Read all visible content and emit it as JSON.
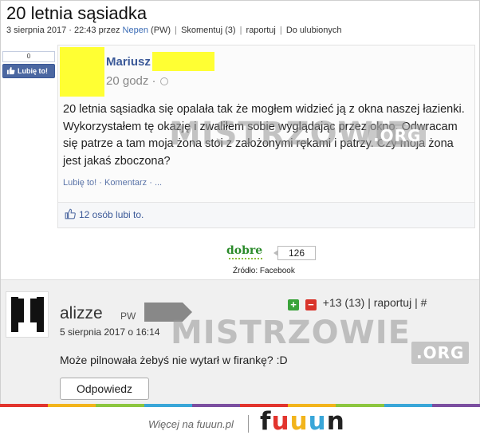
{
  "article": {
    "title": "20 letnia sąsiadka",
    "date": "3 sierpnia 2017 · 22:43 przez",
    "author": "Nepen",
    "author_badge": "(PW)",
    "links": [
      "Skomentuj (3)",
      "raportuj",
      "Do ulubionych"
    ]
  },
  "like_box": {
    "count": "0",
    "label": "Lubię to!"
  },
  "fb_post": {
    "name": "Mariusz",
    "time": "20 godz ·",
    "text": "20 letnia sąsiadka się opalała tak że mogłem widzieć ją z okna naszej łazienki. Wykorzystałem tę okazję i zwaliłem sobie wyglądając przez okno. Odwracam się patrze a tam moja żona stoi z założonymi rękami i patrzy. Czy moja żona jest jakaś zboczona?",
    "actions": "Lubię to! · Komentarz · ...",
    "likes": "12 osób lubi to.",
    "watermark": "MISTRZOWIE",
    "watermark_org": ".ORG"
  },
  "vote": {
    "label": "dobre",
    "count": "126"
  },
  "source": "Źródło: Facebook",
  "comment": {
    "author": "alizze",
    "badge": "PW",
    "date": "5 sierpnia 2017 o 16:14",
    "text": "Może pilnowała żebyś nie wytarł w firankę? :D",
    "reply": "Odpowiedz",
    "plus": "+",
    "minus": "−",
    "score": "+13 (13) | raportuj | #",
    "watermark": "MISTRZOWIE",
    "watermark_org": ".ORG"
  },
  "footer": {
    "text": "Więcej na fuuun.pl",
    "logo_letters": [
      "f",
      "u",
      "u",
      "u",
      "n"
    ],
    "logo_colors": [
      "#222222",
      "#e2342d",
      "#f2b41b",
      "#39a6d8",
      "#222222"
    ],
    "stripe_colors": [
      "#e2342d",
      "#f2b41b",
      "#8cc63f",
      "#39a6d8",
      "#7b4fa0",
      "#e2342d",
      "#f2b41b",
      "#8cc63f",
      "#39a6d8",
      "#7b4fa0"
    ]
  }
}
